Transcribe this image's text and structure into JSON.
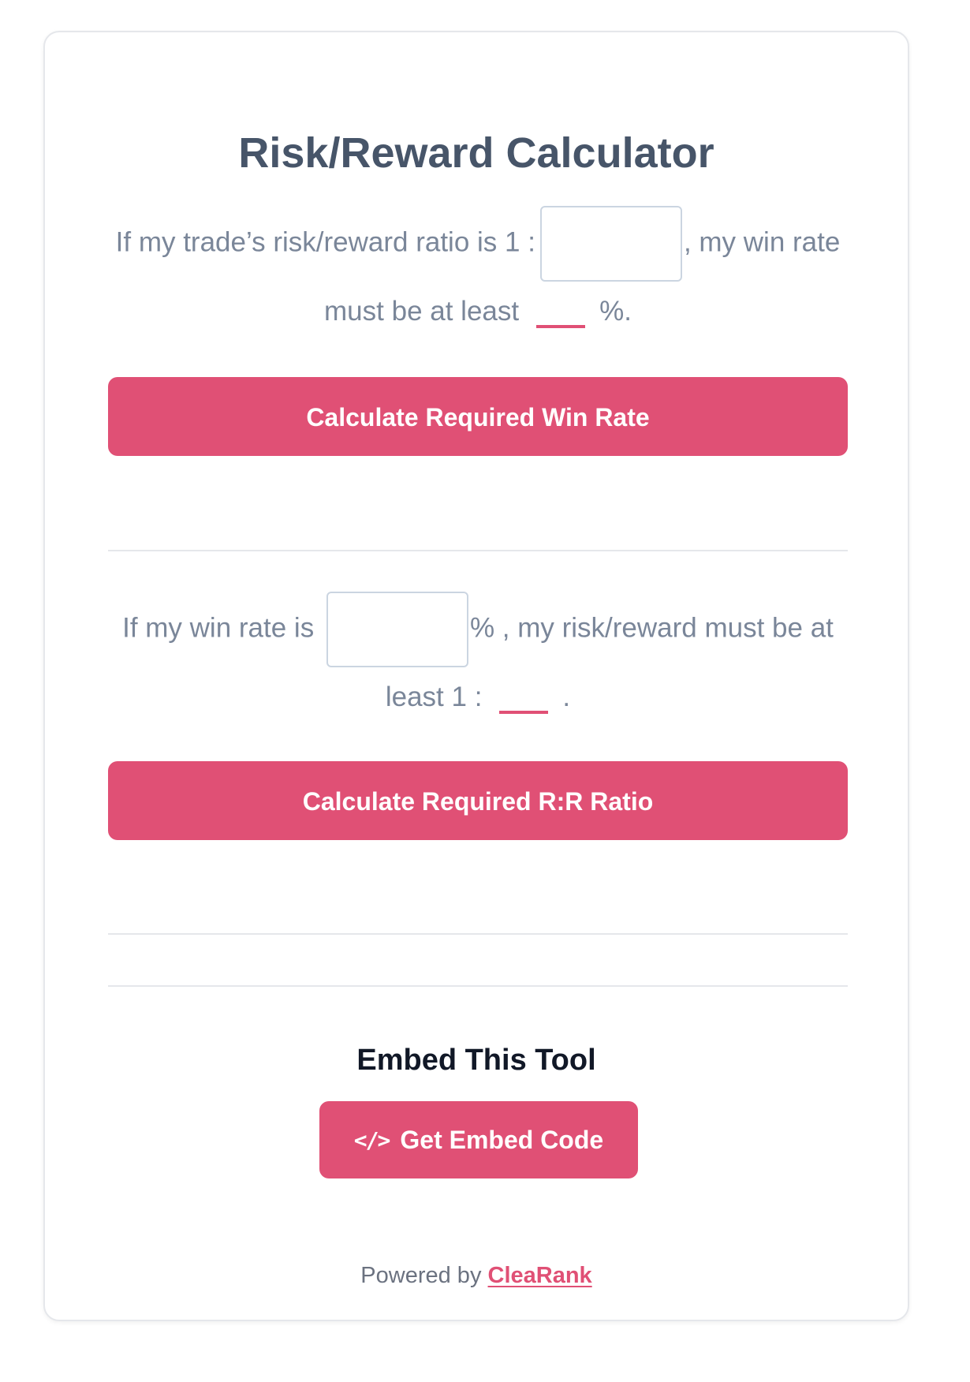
{
  "title": "Risk/Reward Calculator",
  "section1": {
    "prefix": "If my trade’s risk/reward ratio is 1 :",
    "input_value": "",
    "middle": ", my win rate",
    "line2_prefix": "must be at least",
    "result_value": "",
    "suffix": "%.",
    "button_label": "Calculate Required Win Rate"
  },
  "section2": {
    "prefix": "If my win rate is",
    "input_value": "",
    "middle": "% , my risk/reward must be at",
    "line2_prefix": "least 1 :",
    "result_value": "",
    "suffix": ".",
    "button_label": "Calculate Required R:R Ratio"
  },
  "embed": {
    "heading": "Embed This Tool",
    "button_icon": "code-icon",
    "button_icon_glyph": "</>",
    "button_label": "Get Embed Code"
  },
  "footer": {
    "powered_prefix": "Powered by",
    "brand": "CleaRank"
  },
  "colors": {
    "accent": "#e05075",
    "title": "#475569",
    "text": "#7a8699"
  }
}
